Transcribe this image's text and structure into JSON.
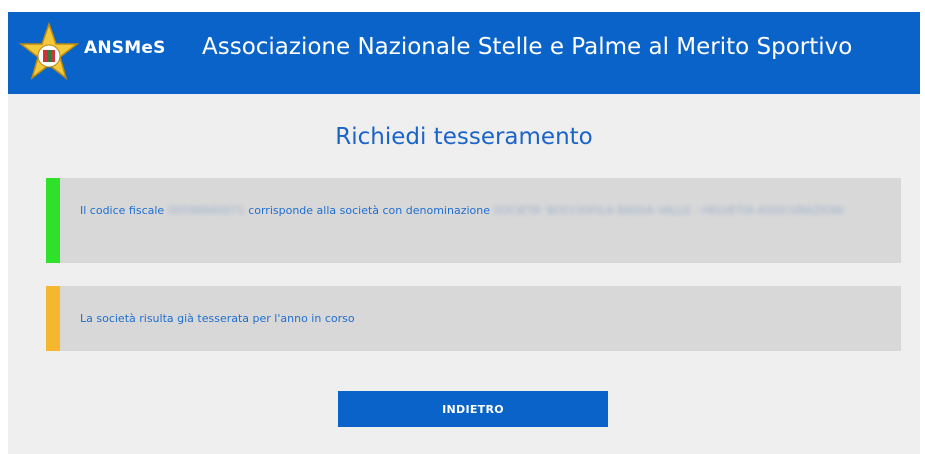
{
  "header": {
    "brand": "ANSMeS",
    "title": "Associazione Nazionale Stelle e Palme al Merito Sportivo"
  },
  "page_title": "Richiedi tesseramento",
  "messages": {
    "success": {
      "prefix": "Il codice fiscale",
      "codice_fiscale": "00598940071",
      "middle": "corrisponde alla società con denominazione",
      "denominazione": "SOCIETA' BOCCIOFILA BASSA VALLE - HELVETIA ASSICURAZIONI",
      "status_color": "#2fe12a"
    },
    "warning": {
      "text": "La società risulta già tesserata per l'anno in corso",
      "status_color": "#f5b630"
    }
  },
  "actions": {
    "back_label": "INDIETRO"
  },
  "colors": {
    "brand_blue": "#0a63c9",
    "text_blue": "#1f6fcf",
    "panel_gray": "#d8d8d8",
    "page_bg": "#efefef"
  }
}
